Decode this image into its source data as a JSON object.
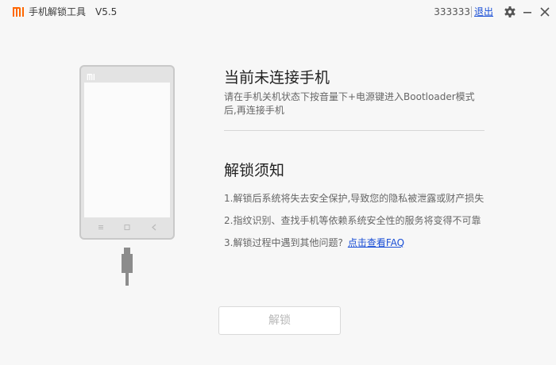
{
  "titlebar": {
    "logo_text": "MI",
    "title": "手机解锁工具",
    "version": "V5.5",
    "user_id": "333333",
    "logout_label": "退出",
    "icons": {
      "settings": "gear-icon",
      "minimize": "minimize-icon",
      "close": "close-icon"
    }
  },
  "phone": {
    "logo_text": "MI",
    "icons": [
      "phone-illustration-icon",
      "usb-cable-icon"
    ]
  },
  "connect": {
    "heading": "当前未连接手机",
    "instruction": "请在手机关机状态下按音量下+电源键进入Bootloader模式后,再连接手机"
  },
  "notes": {
    "heading": "解锁须知",
    "items": [
      "1.解锁后系统将失去安全保护,导致您的隐私被泄露或财产损失",
      "2.指纹识别、查找手机等依赖系统安全性的服务将变得不可靠",
      "3.解锁过程中遇到其他问题?"
    ],
    "faq_link": "点击查看FAQ"
  },
  "actions": {
    "unlock_label": "解锁",
    "unlock_enabled": false
  },
  "colors": {
    "brand": "#ff6700",
    "link": "#1a4fd6",
    "background": "#f7f7f7"
  }
}
